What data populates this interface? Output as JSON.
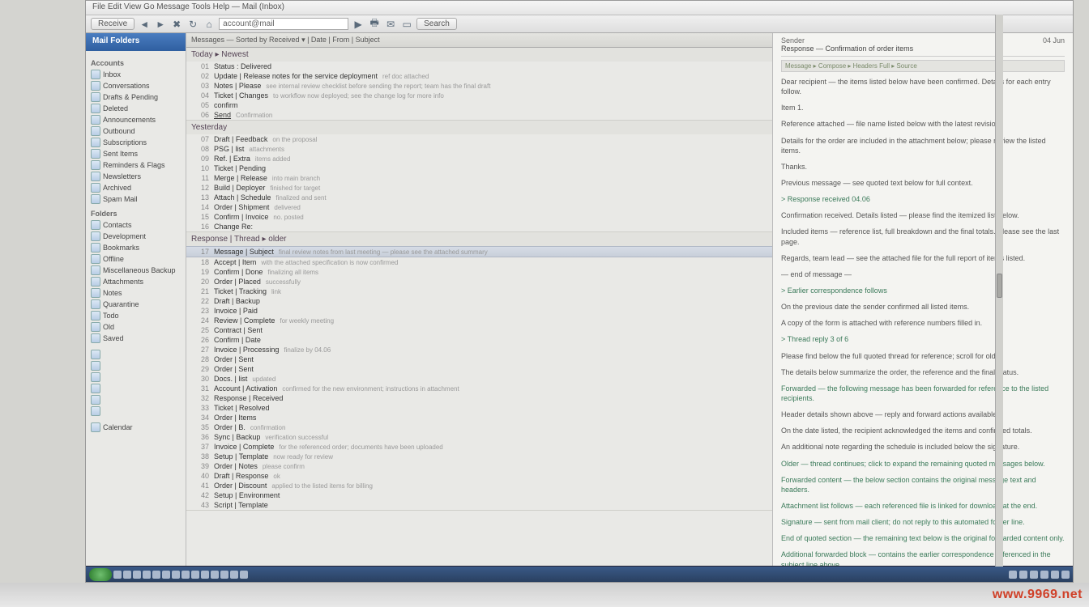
{
  "watermark": "www.9969.net",
  "menubar": "File  Edit  View  Go  Message  Tools  Help — Mail (Inbox)",
  "toolbar": {
    "btn1": "Receive",
    "addr": "account@mail",
    "btn2": "Search"
  },
  "sidebar": {
    "header": "Mail Folders",
    "group1": "Accounts",
    "group2": "Folders",
    "items1": [
      "Inbox",
      "Conversations",
      "Drafts & Pending",
      "Deleted",
      "Announcements",
      "Outbound",
      "Subscriptions",
      "Sent Items",
      "Reminders & Flags",
      "Newsletters",
      "Archived",
      "Spam Mail"
    ],
    "items2": [
      "Contacts",
      "Development",
      "Bookmarks",
      "Offline",
      "Miscellaneous Backup",
      "Attachments",
      "Notes",
      "Quarantine",
      "Todo",
      "Old",
      "Saved"
    ],
    "items3": [
      "",
      "",
      "",
      "",
      "",
      ""
    ],
    "footer": "Calendar"
  },
  "list": {
    "header": "Messages  —  Sorted by Received  ▾  |  Date  |  From  |  Subject",
    "groups": [
      {
        "title": "Today ▸ Newest",
        "rows": [
          {
            "n": "01",
            "t": "Status : Delivered",
            "m": ""
          },
          {
            "n": "02",
            "t": "Update | Release notes for the service deployment",
            "m": "ref doc attached"
          },
          {
            "n": "03",
            "t": "Notes | Please",
            "m": "see internal review checklist before sending the report; team has the final draft"
          },
          {
            "n": "04",
            "t": "Ticket | Changes",
            "m": "to workflow now deployed; see the change log for more info"
          },
          {
            "n": "05",
            "t": "confirm",
            "m": ""
          },
          {
            "n": "06",
            "t": "Send",
            "m": "Confirmation",
            "hl": true
          }
        ]
      },
      {
        "title": "Yesterday",
        "rows": [
          {
            "n": "07",
            "t": "Draft | Feedback",
            "m": "on the proposal"
          },
          {
            "n": "08",
            "t": "PSG | list",
            "m": "attachments"
          },
          {
            "n": "09",
            "t": "Ref. | Extra",
            "m": "items added"
          },
          {
            "n": "10",
            "t": "Ticket | Pending",
            "m": ""
          },
          {
            "n": "11",
            "t": "Merge | Release",
            "m": "into main branch"
          },
          {
            "n": "12",
            "t": "Build | Deployer",
            "m": "finished for target"
          },
          {
            "n": "13",
            "t": "Attach | Schedule",
            "m": "finalized and sent"
          },
          {
            "n": "14",
            "t": "Order | Shipment",
            "m": "delivered"
          },
          {
            "n": "15",
            "t": "Confirm | Invoice",
            "m": "no. posted"
          },
          {
            "n": "16",
            "t": "Change Re:",
            "m": ""
          }
        ]
      },
      {
        "title": "Response | Thread ▸ older",
        "sel": true,
        "rows": [
          {
            "n": "17",
            "t": "Message | Subject",
            "m": "final review notes from last meeting — please see the attached summary",
            "sel": true
          },
          {
            "n": "18",
            "t": "Accept | Item",
            "m": "with the attached specification is now confirmed"
          },
          {
            "n": "19",
            "t": "Confirm | Done",
            "m": "finalizing all items"
          },
          {
            "n": "20",
            "t": "Order | Placed",
            "m": "successfully"
          },
          {
            "n": "21",
            "t": "Ticket | Tracking",
            "m": "link"
          },
          {
            "n": "22",
            "t": "Draft | Backup",
            "m": ""
          },
          {
            "n": "23",
            "t": "Invoice | Paid",
            "m": ""
          },
          {
            "n": "24",
            "t": "Review | Complete",
            "m": "for weekly meeting"
          },
          {
            "n": "25",
            "t": "Contract | Sent",
            "m": ""
          },
          {
            "n": "26",
            "t": "Confirm | Date",
            "m": ""
          },
          {
            "n": "27",
            "t": "Invoice | Processing",
            "m": "finalize by 04.06"
          },
          {
            "n": "28",
            "t": "Order | Sent",
            "m": ""
          },
          {
            "n": "29",
            "t": "Order | Sent",
            "m": ""
          },
          {
            "n": "30",
            "t": "Docs. | list",
            "m": "updated"
          },
          {
            "n": "31",
            "t": "Account | Activation",
            "m": "confirmed for the new environment; instructions in attachment"
          },
          {
            "n": "32",
            "t": "Response | Received",
            "m": ""
          },
          {
            "n": "33",
            "t": "Ticket | Resolved",
            "m": ""
          },
          {
            "n": "34",
            "t": "Order | Items",
            "m": ""
          },
          {
            "n": "35",
            "t": "Order | B.",
            "m": "confirmation"
          },
          {
            "n": "36",
            "t": "Sync | Backup",
            "m": "verification successful"
          },
          {
            "n": "37",
            "t": "Invoice | Complete",
            "m": "for the referenced order; documents have been uploaded"
          },
          {
            "n": "38",
            "t": "Setup | Template",
            "m": "now ready for review"
          },
          {
            "n": "39",
            "t": "Order | Notes",
            "m": "please confirm"
          },
          {
            "n": "40",
            "t": "Draft | Response",
            "m": "ok"
          },
          {
            "n": "41",
            "t": "Order | Discount",
            "m": "applied to the listed items for billing"
          },
          {
            "n": "42",
            "t": "Setup | Environment",
            "m": ""
          },
          {
            "n": "43",
            "t": "Script | Template",
            "m": ""
          }
        ]
      }
    ]
  },
  "preview": {
    "from": "Sender",
    "date": "04 Jun",
    "subject": "Response — Confirmation of order items",
    "tabs": "Message ▸  Compose ▸  Headers  Full ▸  Source",
    "body": [
      {
        "cls": "",
        "t": "Dear recipient — the items listed below have been confirmed. Details for each entry follow."
      },
      {
        "cls": "",
        "t": "Item 1."
      },
      {
        "cls": "",
        "t": "Reference attached — file name listed below with the latest revision."
      },
      {
        "cls": "",
        "t": "Details for the order are included in the attachment below; please review the listed items."
      },
      {
        "cls": "",
        "t": "Thanks."
      },
      {
        "cls": "",
        "t": "Previous message — see quoted text below for full context."
      },
      {
        "cls": "green",
        "t": "> Response received 04.06"
      },
      {
        "cls": "",
        "t": "Confirmation received. Details listed — please find the itemized list below."
      },
      {
        "cls": "",
        "t": "Included items — reference list, full breakdown and the final totals. Please see the last page."
      },
      {
        "cls": "",
        "t": "Regards, team lead — see the attached file for the full report of items listed."
      },
      {
        "cls": "",
        "t": "— end of message —"
      },
      {
        "cls": "green",
        "t": "> Earlier correspondence follows"
      },
      {
        "cls": "",
        "t": "On the previous date the sender confirmed all listed items."
      },
      {
        "cls": "",
        "t": "A copy of the form is attached with reference numbers filled in."
      },
      {
        "cls": "green",
        "t": "> Thread reply 3 of 6"
      },
      {
        "cls": "",
        "t": "Please find below the full quoted thread for reference; scroll for older."
      },
      {
        "cls": "",
        "t": "The details below summarize the order, the reference and the final status."
      },
      {
        "cls": "green",
        "t": "Forwarded — the following message has been forwarded for reference to the listed recipients."
      },
      {
        "cls": "",
        "t": "Header details shown above — reply and forward actions available."
      },
      {
        "cls": "",
        "t": "On the date listed, the recipient acknowledged the items and confirmed totals."
      },
      {
        "cls": "",
        "t": "An additional note regarding the schedule is included below the signature."
      },
      {
        "cls": "green",
        "t": "Older — thread continues; click to expand the remaining quoted messages below."
      },
      {
        "cls": "green",
        "t": "Forwarded content — the below section contains the original message text and headers."
      },
      {
        "cls": "green",
        "t": "Attachment list follows — each referenced file is linked for download at the end."
      },
      {
        "cls": "green",
        "t": "Signature — sent from mail client; do not reply to this automated footer line."
      },
      {
        "cls": "green",
        "t": "End of quoted section — the remaining text below is the original forwarded content only."
      },
      {
        "cls": "green",
        "t": "Additional forwarded block — contains the earlier correspondence referenced in the subject line above."
      }
    ]
  }
}
